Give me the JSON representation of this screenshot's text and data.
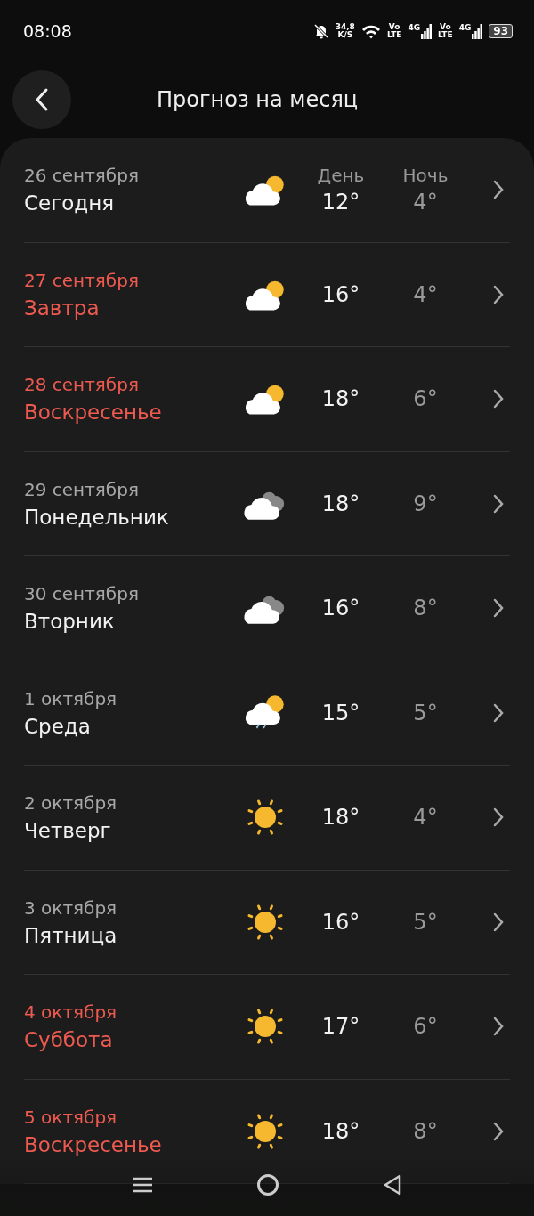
{
  "status_bar": {
    "time": "08:08",
    "speed": "34,8",
    "speed_unit": "K/S",
    "volte_1": [
      "Vo",
      "LTE"
    ],
    "network_1": "4G",
    "volte_2": [
      "Vo",
      "LTE"
    ],
    "network_2": "4G",
    "battery": "93"
  },
  "header": {
    "title": "Прогноз на месяц"
  },
  "columns": {
    "day": "День",
    "night": "Ночь"
  },
  "days": [
    {
      "date": "26 сентября",
      "weekday": "Сегодня",
      "weekend": false,
      "kind": "partly_cloudy",
      "day": "12°",
      "night": "4°"
    },
    {
      "date": "27 сентября",
      "weekday": "Завтра",
      "weekend": true,
      "kind": "partly_cloudy",
      "day": "16°",
      "night": "4°"
    },
    {
      "date": "28 сентября",
      "weekday": "Воскресенье",
      "weekend": true,
      "kind": "partly_cloudy",
      "day": "18°",
      "night": "6°"
    },
    {
      "date": "29 сентября",
      "weekday": "Понедельник",
      "weekend": false,
      "kind": "cloudy",
      "day": "18°",
      "night": "9°"
    },
    {
      "date": "30 сентября",
      "weekday": "Вторник",
      "weekend": false,
      "kind": "cloudy",
      "day": "16°",
      "night": "8°"
    },
    {
      "date": "1 октября",
      "weekday": "Среда",
      "weekend": false,
      "kind": "rain",
      "day": "15°",
      "night": "5°"
    },
    {
      "date": "2 октября",
      "weekday": "Четверг",
      "weekend": false,
      "kind": "sunny",
      "day": "18°",
      "night": "4°"
    },
    {
      "date": "3 октября",
      "weekday": "Пятница",
      "weekend": false,
      "kind": "sunny",
      "day": "16°",
      "night": "5°"
    },
    {
      "date": "4 октября",
      "weekday": "Суббота",
      "weekend": true,
      "kind": "sunny",
      "day": "17°",
      "night": "6°"
    },
    {
      "date": "5 октября",
      "weekday": "Воскресенье",
      "weekend": true,
      "kind": "sunny",
      "day": "18°",
      "night": "8°"
    }
  ]
}
